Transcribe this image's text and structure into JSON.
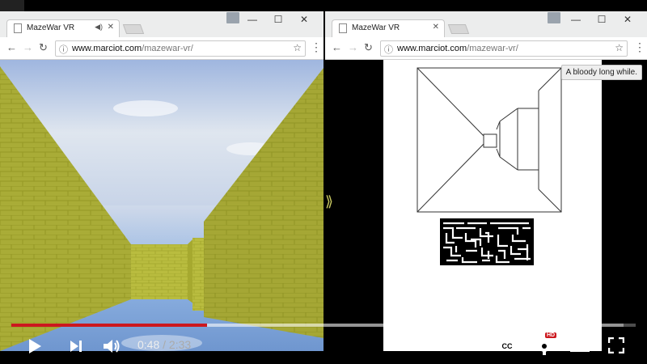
{
  "left_browser": {
    "tab_title": "MazeWar VR",
    "url_host": "www.marciot.com",
    "url_path": "/mazewar-vr/"
  },
  "right_browser": {
    "tab_title": "MazeWar VR",
    "url_host": "www.marciot.com",
    "url_path": "/mazewar-vr/",
    "tooltip": "A bloody long while."
  },
  "player": {
    "current_time": "0:48",
    "separator": "/",
    "duration": "2:33",
    "played_fraction": 0.313,
    "loaded_fraction": 0.98,
    "hd_badge": "HD",
    "accent": "#cc181e"
  },
  "icons": {
    "play": "play-icon",
    "next": "next-icon",
    "volume": "volume-icon",
    "captions": "captions-icon",
    "settings": "settings-icon",
    "theater": "theater-mode-icon",
    "fullscreen": "fullscreen-icon",
    "audio": "audio-icon"
  },
  "colors": {
    "wall": "#b8bb3a",
    "sky": "#8fb0de"
  }
}
